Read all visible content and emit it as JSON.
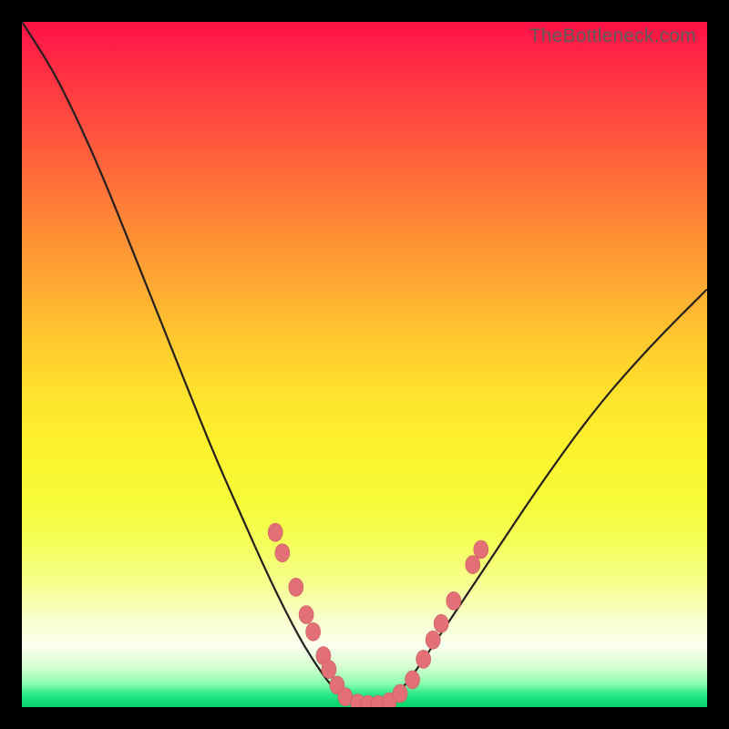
{
  "watermark": "TheBottleneck.com",
  "colors": {
    "frame": "#000000",
    "curve_stroke": "#231f20",
    "dot_fill": "#e37076",
    "dot_stroke": "#c85a60"
  },
  "chart_data": {
    "type": "line",
    "title": "",
    "xlabel": "",
    "ylabel": "",
    "xlim": [
      0,
      1
    ],
    "ylim": [
      0,
      1
    ],
    "series": [
      {
        "name": "bottleneck-curve",
        "x": [
          0.0,
          0.04,
          0.08,
          0.12,
          0.16,
          0.2,
          0.24,
          0.28,
          0.32,
          0.36,
          0.4,
          0.43,
          0.46,
          0.49,
          0.52,
          0.55,
          0.58,
          0.62,
          0.68,
          0.76,
          0.84,
          0.92,
          1.0
        ],
        "y": [
          1.0,
          0.94,
          0.86,
          0.77,
          0.67,
          0.57,
          0.47,
          0.37,
          0.28,
          0.19,
          0.11,
          0.06,
          0.02,
          0.005,
          0.005,
          0.02,
          0.06,
          0.12,
          0.21,
          0.33,
          0.44,
          0.53,
          0.61
        ]
      }
    ],
    "markers": {
      "name": "highlight-dots",
      "points": [
        {
          "x": 0.37,
          "y": 0.255
        },
        {
          "x": 0.38,
          "y": 0.225
        },
        {
          "x": 0.4,
          "y": 0.175
        },
        {
          "x": 0.415,
          "y": 0.135
        },
        {
          "x": 0.425,
          "y": 0.11
        },
        {
          "x": 0.44,
          "y": 0.075
        },
        {
          "x": 0.448,
          "y": 0.055
        },
        {
          "x": 0.46,
          "y": 0.032
        },
        {
          "x": 0.472,
          "y": 0.015
        },
        {
          "x": 0.49,
          "y": 0.006
        },
        {
          "x": 0.505,
          "y": 0.004
        },
        {
          "x": 0.52,
          "y": 0.004
        },
        {
          "x": 0.536,
          "y": 0.008
        },
        {
          "x": 0.552,
          "y": 0.02
        },
        {
          "x": 0.57,
          "y": 0.04
        },
        {
          "x": 0.586,
          "y": 0.07
        },
        {
          "x": 0.6,
          "y": 0.098
        },
        {
          "x": 0.612,
          "y": 0.122
        },
        {
          "x": 0.63,
          "y": 0.155
        },
        {
          "x": 0.658,
          "y": 0.208
        },
        {
          "x": 0.67,
          "y": 0.23
        }
      ]
    }
  }
}
